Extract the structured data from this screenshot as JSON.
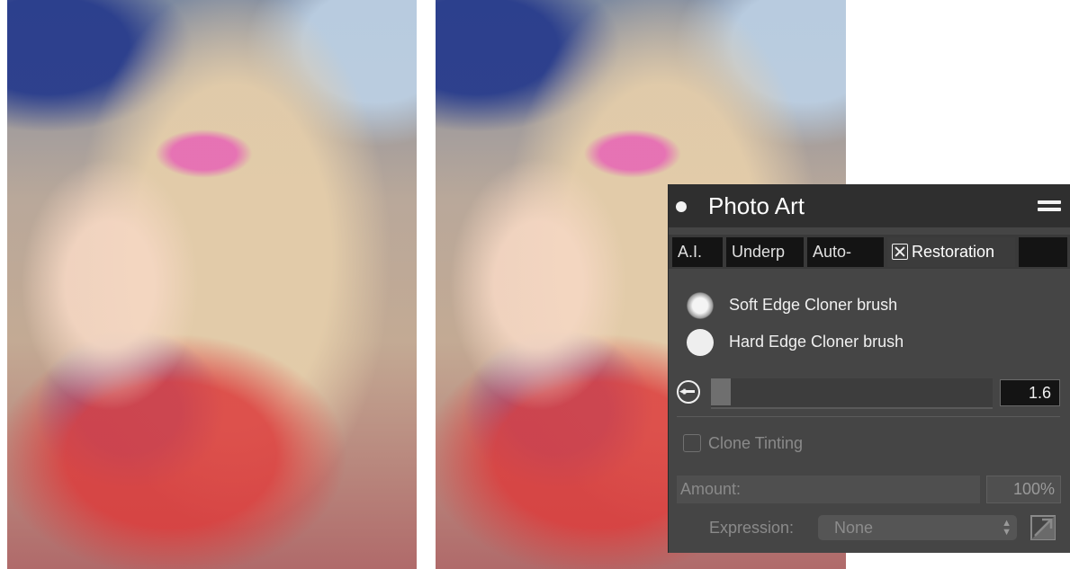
{
  "images": [
    {
      "name": "painted photo left"
    },
    {
      "name": "painted photo right"
    }
  ],
  "panel": {
    "title": "Photo Art",
    "tabs": [
      {
        "label": "A.I."
      },
      {
        "label": "Underp"
      },
      {
        "label": "Auto-"
      },
      {
        "label": "Restoration",
        "active": true
      },
      {
        "label": ""
      }
    ],
    "brushes": [
      {
        "label": "Soft Edge Cloner brush",
        "icon": "soft-brush-icon"
      },
      {
        "label": "Hard Edge Cloner brush",
        "icon": "hard-brush-icon"
      }
    ],
    "size": {
      "value": "1.6",
      "fill_fraction": 0.07
    },
    "clone_tinting": {
      "label": "Clone Tinting",
      "checked": false
    },
    "amount": {
      "label": "Amount:",
      "value": "100%"
    },
    "expression": {
      "label": "Expression:",
      "value": "None"
    }
  },
  "colors": {
    "panel_bg": "#454545",
    "header_bg": "#2f2f2f",
    "field_bg": "#141414",
    "disabled_text": "#8a8a8a"
  }
}
